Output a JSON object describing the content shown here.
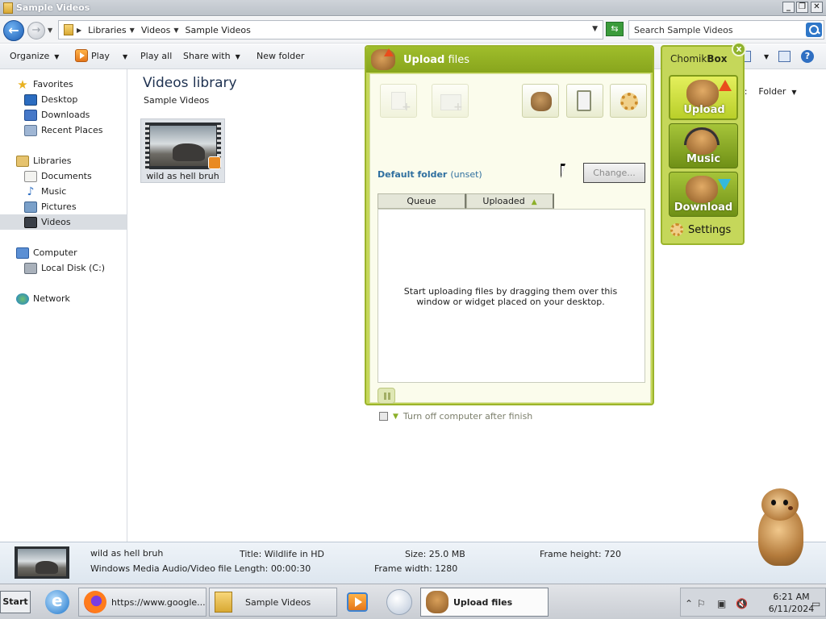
{
  "window": {
    "title": "Sample Videos"
  },
  "address": {
    "crumbs": [
      "Libraries",
      "Videos",
      "Sample Videos"
    ],
    "search_placeholder": "Search Sample Videos"
  },
  "toolbar": {
    "organize": "Organize",
    "play": "Play",
    "play_all": "Play all",
    "share_with": "Share with",
    "new_folder": "New folder",
    "arrange_label": "y:",
    "arrange_value": "Folder"
  },
  "sidebar": {
    "favorites": "Favorites",
    "desktop": "Desktop",
    "downloads": "Downloads",
    "recent_places": "Recent Places",
    "libraries": "Libraries",
    "documents": "Documents",
    "music": "Music",
    "pictures": "Pictures",
    "videos": "Videos",
    "computer": "Computer",
    "local_disk": "Local Disk (C:)",
    "network": "Network"
  },
  "main": {
    "title": "Videos library",
    "subtitle": "Sample Videos",
    "file_name": "wild as hell bruh"
  },
  "details": {
    "name": "wild as hell bruh",
    "type_length": "Windows Media Audio/Video file Length: 00:00:30",
    "title": "Title: Wildlife in HD",
    "size": "Size: 25.0 MB",
    "frame_width": "Frame width: 1280",
    "frame_height": "Frame height: 720"
  },
  "upload_window": {
    "title_bold": "Upload",
    "title_rest": " files",
    "default_folder_label": "Default folder",
    "default_folder_value": "(unset)",
    "change_button": "Change...",
    "tab_queue": "Queue",
    "tab_uploaded": "Uploaded",
    "empty_message": "Start uploading files by dragging them over this window or widget placed on your desktop.",
    "shutdown_label": "Turn off computer after finish"
  },
  "widget": {
    "title_normal": "Chomik",
    "title_bold": "Box",
    "upload": "Upload",
    "music": "Music",
    "download": "Download",
    "settings": "Settings"
  },
  "taskbar": {
    "start": "Start",
    "firefox_task": "https://www.google....",
    "explorer_task": "Sample Videos",
    "upload_task": "Upload files",
    "time": "6:21 AM",
    "date": "6/11/2024"
  },
  "colors": {
    "chomik_green": "#c5d75a",
    "link_blue": "#2f6f9f"
  }
}
